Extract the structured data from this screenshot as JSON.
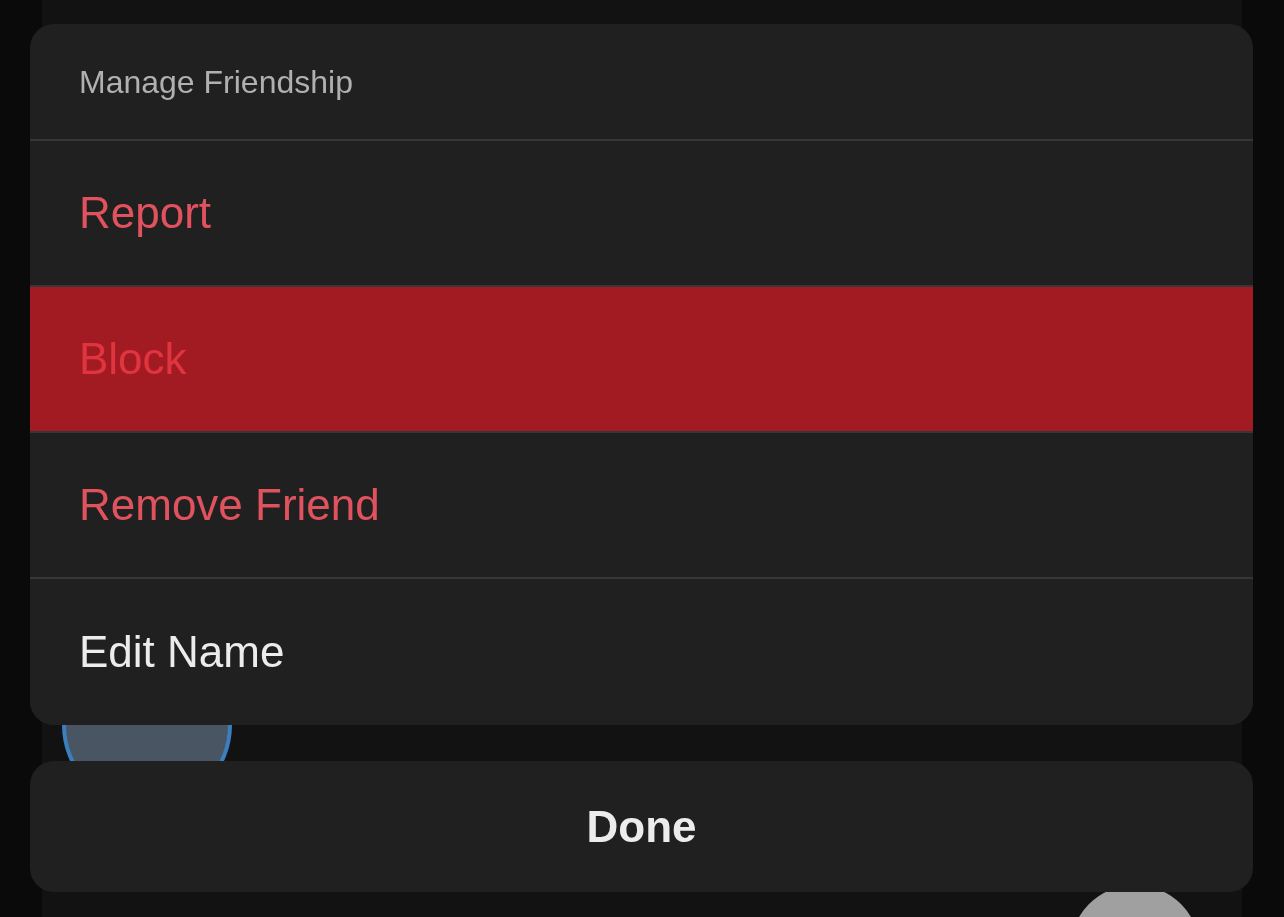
{
  "sheet": {
    "title": "Manage Friendship",
    "items": [
      {
        "label": "Report",
        "kind": "destructive",
        "selected": false
      },
      {
        "label": "Block",
        "kind": "destructive",
        "selected": true
      },
      {
        "label": "Remove Friend",
        "kind": "destructive",
        "selected": false
      },
      {
        "label": "Edit Name",
        "kind": "normal",
        "selected": false
      }
    ],
    "done": "Done"
  }
}
